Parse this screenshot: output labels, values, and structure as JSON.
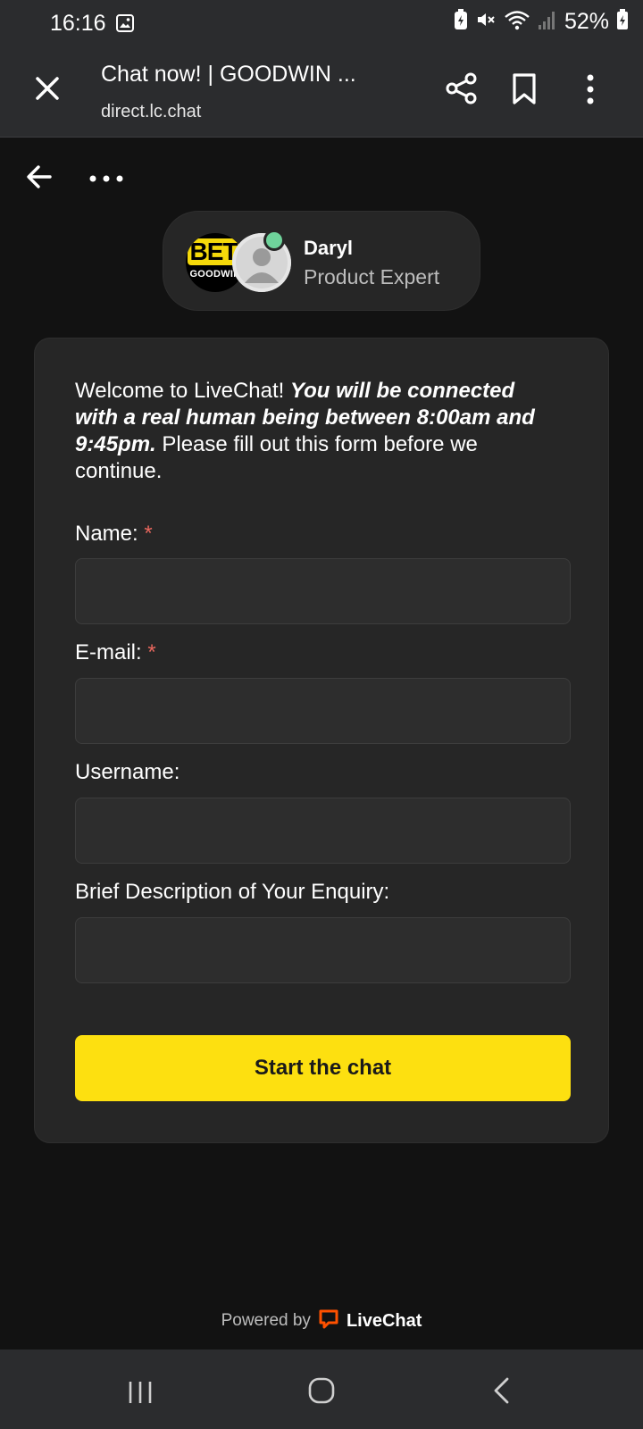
{
  "status_bar": {
    "time": "16:16",
    "battery": "52%"
  },
  "browser": {
    "title": "Chat now! | GOODWIN ...",
    "url": "direct.lc.chat"
  },
  "agent": {
    "logo_text_top": "BET",
    "logo_text_bottom": "GOODWIN",
    "name": "Daryl",
    "role": "Product Expert",
    "online_color": "#6fd39b"
  },
  "form": {
    "welcome_prefix": "Welcome to LiveChat! ",
    "welcome_bold": "You will be connected with a real human being between 8:00am and 9:45pm.",
    "welcome_suffix": " Please fill out this form before we continue.",
    "fields": [
      {
        "label": "Name:",
        "required": "*",
        "value": ""
      },
      {
        "label": "E-mail:",
        "required": "*",
        "value": ""
      },
      {
        "label": "Username:",
        "required": "",
        "value": ""
      },
      {
        "label": "Brief Description of Your Enquiry:",
        "required": "",
        "value": ""
      }
    ],
    "submit_label": "Start the chat",
    "accent_color": "#fde010"
  },
  "footer": {
    "powered_by": "Powered by",
    "brand": "LiveChat"
  }
}
